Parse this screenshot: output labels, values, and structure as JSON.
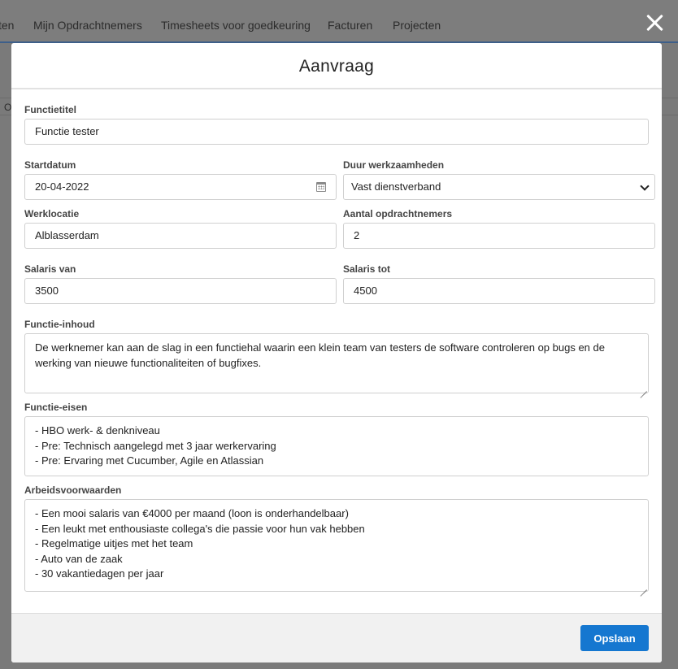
{
  "background_nav": {
    "tabs": [
      "ten",
      "Mijn Opdrachtnemers",
      "Timesheets voor goedkeuring",
      "Facturen",
      "Projecten"
    ],
    "row_fragment": "O"
  },
  "modal": {
    "title": "Aanvraag",
    "close_icon": "close-icon",
    "fields": {
      "functietitel": {
        "label": "Functietitel",
        "value": "Functie tester"
      },
      "startdatum": {
        "label": "Startdatum",
        "value": "20-04-2022",
        "icon": "calendar-icon"
      },
      "duur": {
        "label": "Duur werkzaamheden",
        "value": "Vast dienstverband"
      },
      "werklocatie": {
        "label": "Werklocatie",
        "value": "Alblasserdam"
      },
      "aantal": {
        "label": "Aantal opdrachtnemers",
        "value": "2"
      },
      "salaris_van": {
        "label": "Salaris van",
        "value": "3500"
      },
      "salaris_tot": {
        "label": "Salaris tot",
        "value": "4500"
      },
      "functie_inhoud": {
        "label": "Functie-inhoud",
        "value": "De werknemer kan aan de slag in een functiehal waarin een klein team van testers de software controleren op bugs en de werking van nieuwe functionaliteiten of bugfixes."
      },
      "functie_eisen": {
        "label": "Functie-eisen",
        "lines": [
          "- HBO werk- & denkniveau",
          "- Pre: Technisch aangelegd met 3 jaar werkervaring",
          "- Pre: Ervaring met Cucumber, Agile en Atlassian"
        ]
      },
      "arbeidsvoorwaarden": {
        "label": "Arbeidsvoorwaarden",
        "lines": [
          "- Een mooi salaris van €4000 per maand (loon is onderhandelbaar)",
          "- Een leukt met enthousiaste collega's die passie voor hun vak hebben",
          "- Regelmatige uitjes met het team",
          "- Auto van de zaak",
          "- 30 vakantiedagen per jaar"
        ]
      }
    },
    "footer": {
      "save_label": "Opslaan"
    },
    "colors": {
      "primary": "#1577d0",
      "overlay": "#7a7a7a"
    }
  }
}
